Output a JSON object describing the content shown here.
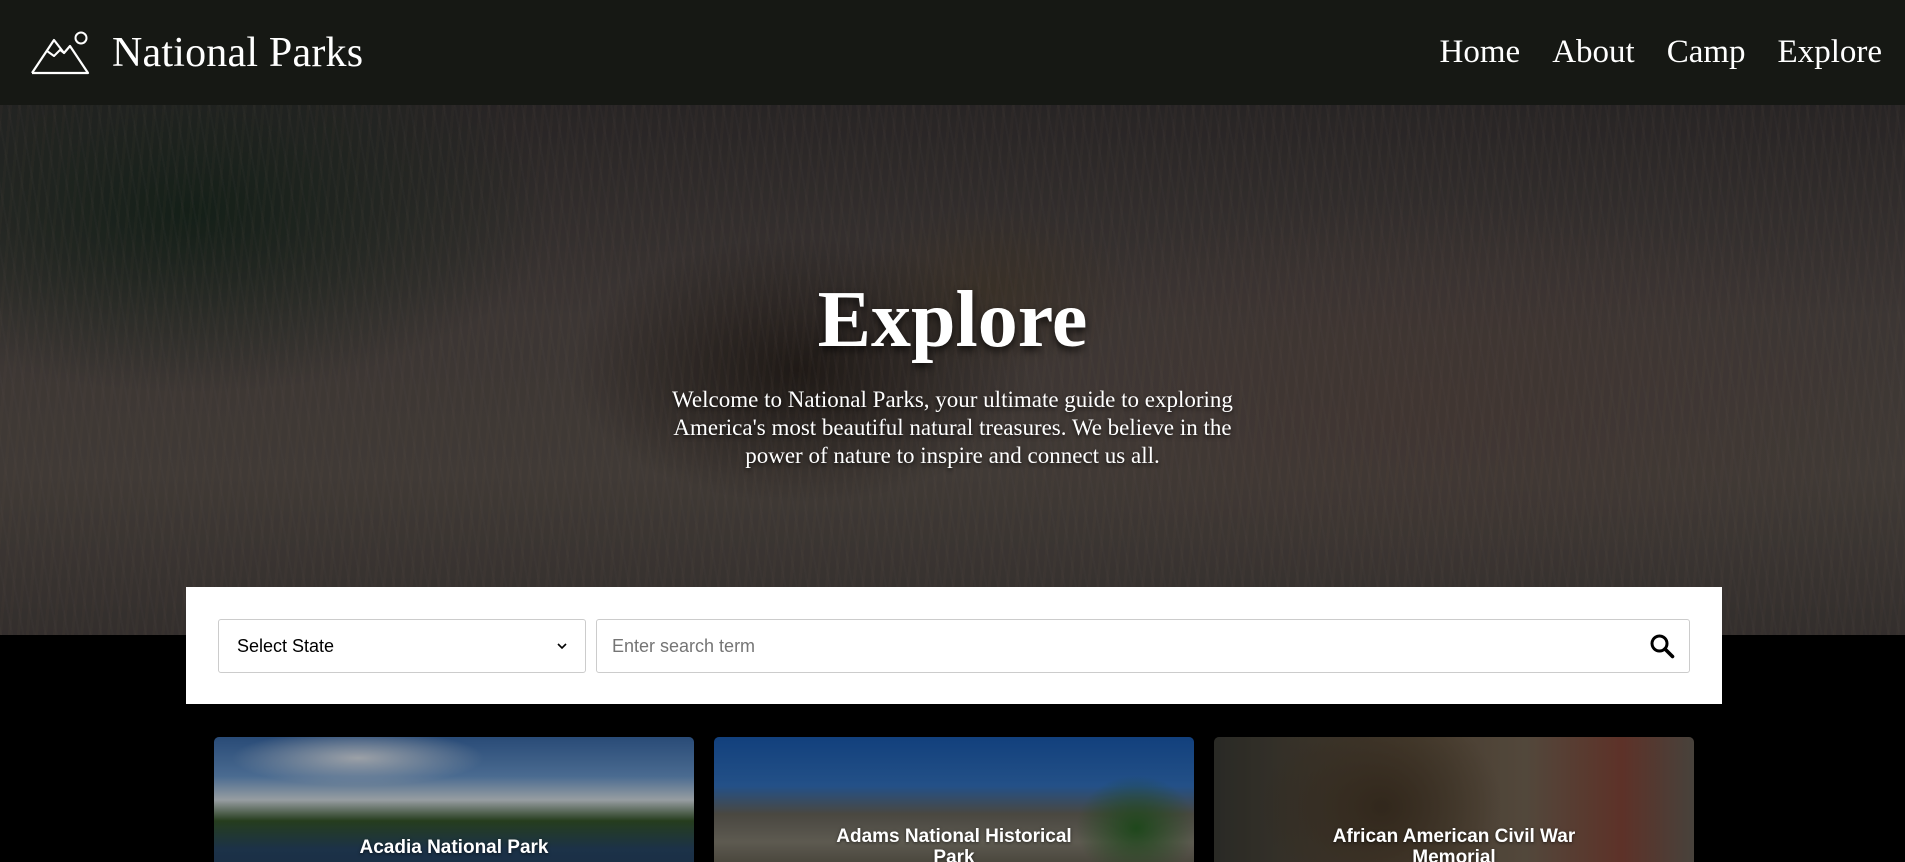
{
  "brand": {
    "title": "National Parks",
    "logo_icon": "mountain-icon"
  },
  "nav": {
    "items": [
      {
        "label": "Home"
      },
      {
        "label": "About"
      },
      {
        "label": "Camp"
      },
      {
        "label": "Explore"
      }
    ]
  },
  "hero": {
    "title": "Explore",
    "text": "Welcome to National Parks, your ultimate guide to exploring America's most beautiful natural treasures. We believe in the power of nature to inspire and connect us all."
  },
  "search": {
    "state_select_value": "Select State",
    "input_value": "",
    "input_placeholder": "Enter search term",
    "button_icon": "search-icon"
  },
  "cards": [
    {
      "title": "Acadia National Park"
    },
    {
      "title": "Adams National Historical Park"
    },
    {
      "title": "African American Civil War Memorial"
    }
  ],
  "colors": {
    "navbar_bg": "#161814",
    "page_bg": "#000000",
    "panel_bg": "#ffffff"
  }
}
